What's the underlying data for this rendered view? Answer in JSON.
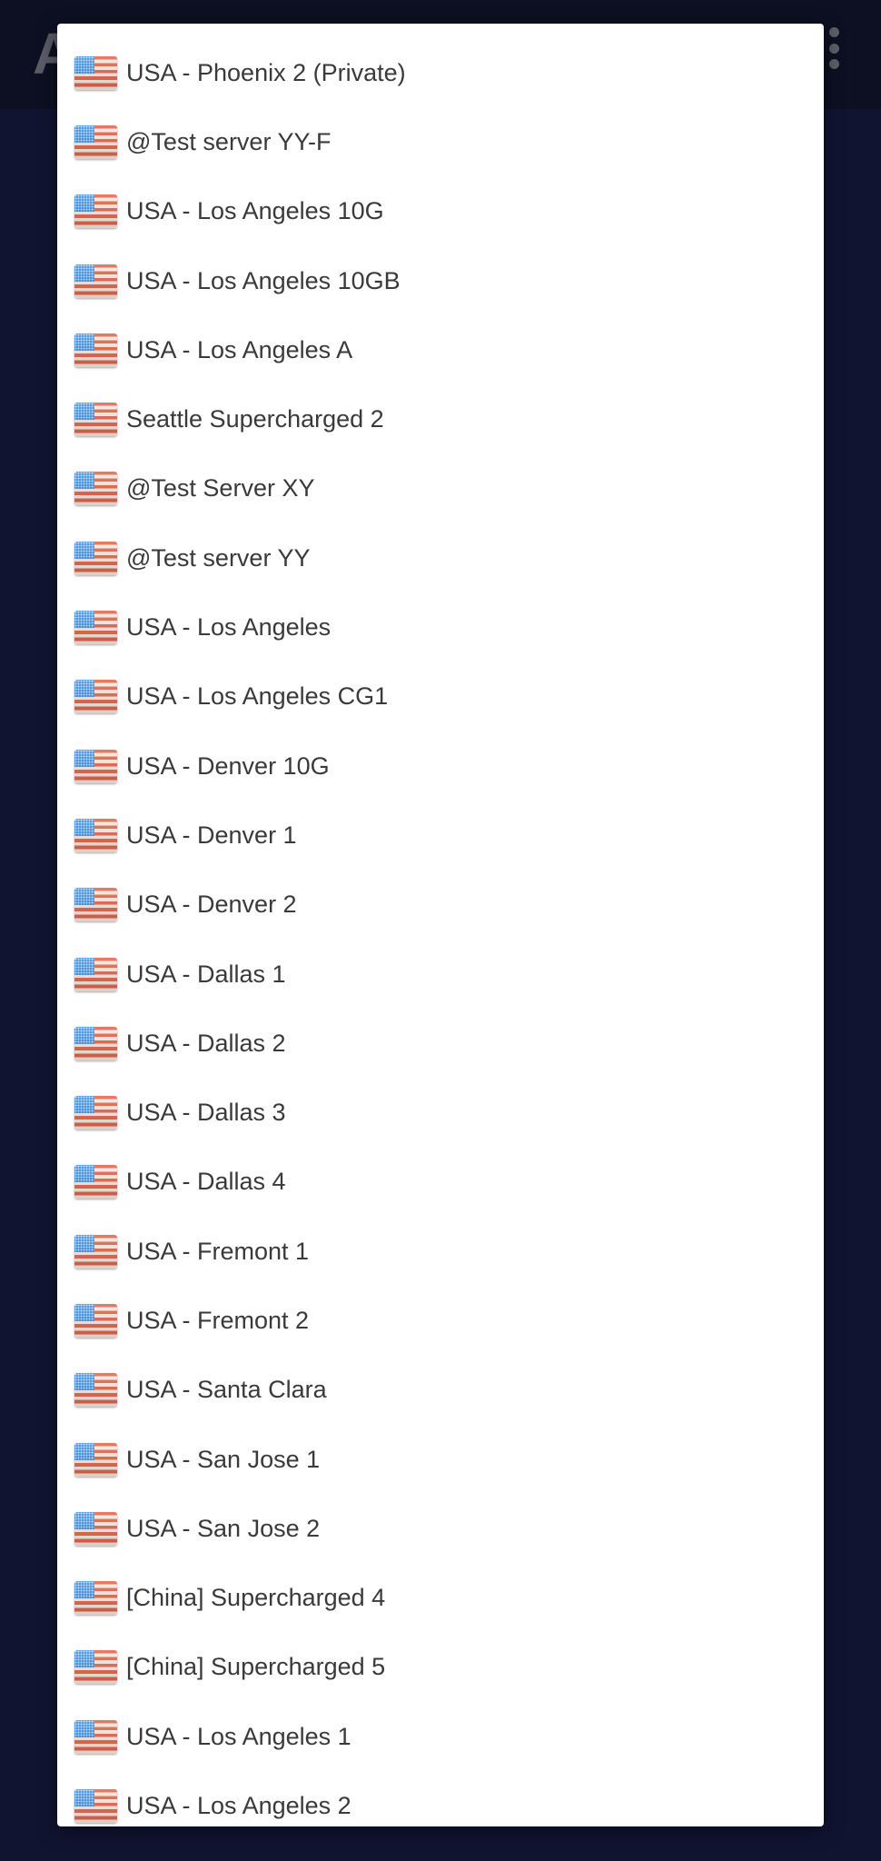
{
  "app": {
    "title_partial": "A",
    "overflow_menu_icon": "more-vert-icon"
  },
  "dialog": {
    "items": [
      {
        "label": "USA - Phoenix 2 (Private)",
        "flag": "us-flag-icon"
      },
      {
        "label": "@Test server YY-F",
        "flag": "us-flag-icon"
      },
      {
        "label": "USA - Los Angeles 10G",
        "flag": "us-flag-icon"
      },
      {
        "label": "USA - Los Angeles 10GB",
        "flag": "us-flag-icon"
      },
      {
        "label": "USA - Los Angeles A",
        "flag": "us-flag-icon"
      },
      {
        "label": "Seattle Supercharged 2",
        "flag": "us-flag-icon"
      },
      {
        "label": "@Test Server XY",
        "flag": "us-flag-icon"
      },
      {
        "label": "@Test server YY",
        "flag": "us-flag-icon"
      },
      {
        "label": "USA - Los Angeles",
        "flag": "us-flag-icon"
      },
      {
        "label": "USA - Los Angeles CG1",
        "flag": "us-flag-icon"
      },
      {
        "label": "USA - Denver 10G",
        "flag": "us-flag-icon"
      },
      {
        "label": "USA - Denver 1",
        "flag": "us-flag-icon"
      },
      {
        "label": "USA - Denver 2",
        "flag": "us-flag-icon"
      },
      {
        "label": "USA - Dallas 1",
        "flag": "us-flag-icon"
      },
      {
        "label": "USA - Dallas 2",
        "flag": "us-flag-icon"
      },
      {
        "label": "USA - Dallas 3",
        "flag": "us-flag-icon"
      },
      {
        "label": "USA - Dallas 4",
        "flag": "us-flag-icon"
      },
      {
        "label": "USA - Fremont 1",
        "flag": "us-flag-icon"
      },
      {
        "label": "USA - Fremont 2",
        "flag": "us-flag-icon"
      },
      {
        "label": "USA - Santa Clara",
        "flag": "us-flag-icon"
      },
      {
        "label": "USA - San Jose 1",
        "flag": "us-flag-icon"
      },
      {
        "label": "USA - San Jose 2",
        "flag": "us-flag-icon"
      },
      {
        "label": "[China] Supercharged 4",
        "flag": "us-flag-icon"
      },
      {
        "label": "[China] Supercharged 5",
        "flag": "us-flag-icon"
      },
      {
        "label": "USA - Los Angeles 1",
        "flag": "us-flag-icon"
      },
      {
        "label": "USA - Los Angeles 2",
        "flag": "us-flag-icon"
      }
    ]
  },
  "colors": {
    "background": "#13183a",
    "appbar": "#0f1329",
    "dialog": "#ffffff",
    "text": "#3a3a3a"
  }
}
